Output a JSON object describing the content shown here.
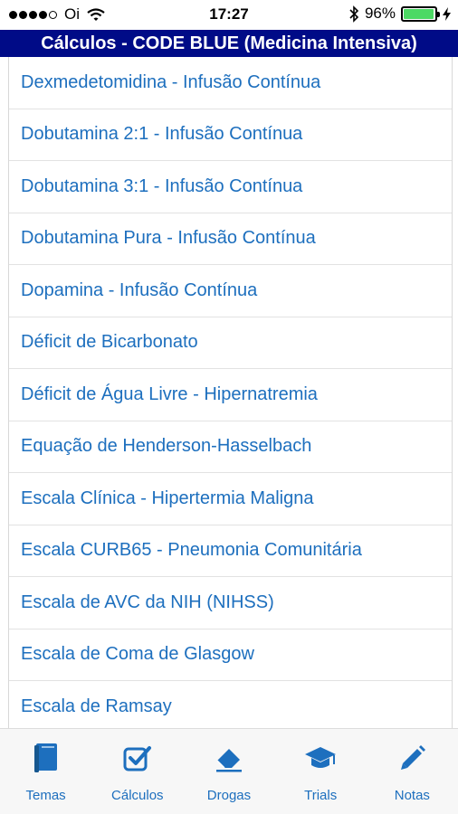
{
  "status": {
    "carrier": "Oi",
    "time": "17:27",
    "battery": "96%",
    "battery_level": 0.96
  },
  "header": {
    "title": "Cálculos - CODE BLUE (Medicina Intensiva)"
  },
  "list": [
    "Dexmedetomidina - Infusão Contínua",
    "Dobutamina 2:1 - Infusão Contínua",
    "Dobutamina 3:1 - Infusão Contínua",
    "Dobutamina Pura - Infusão Contínua",
    "Dopamina - Infusão Contínua",
    "Déficit de Bicarbonato",
    "Déficit de Água Livre - Hipernatremia",
    "Equação de Henderson-Hasselbach",
    "Escala Clínica - Hipertermia Maligna",
    "Escala CURB65 - Pneumonia Comunitária",
    "Escala de AVC da NIH (NIHSS)",
    "Escala de Coma de Glasgow",
    "Escala de Ramsay"
  ],
  "tabs": {
    "temas": "Temas",
    "calculos": "Cálculos",
    "drogas": "Drogas",
    "trials": "Trials",
    "notas": "Notas"
  },
  "colors": {
    "accent": "#1d6fbe",
    "header_bg": "#000b87",
    "battery": "#4cd964"
  },
  "icons": [
    "signal-dots-icon",
    "wifi-icon",
    "bluetooth-icon",
    "battery-icon",
    "charging-icon",
    "book-icon",
    "checkbox-icon",
    "eraser-icon",
    "graduation-cap-icon",
    "pencil-icon"
  ]
}
